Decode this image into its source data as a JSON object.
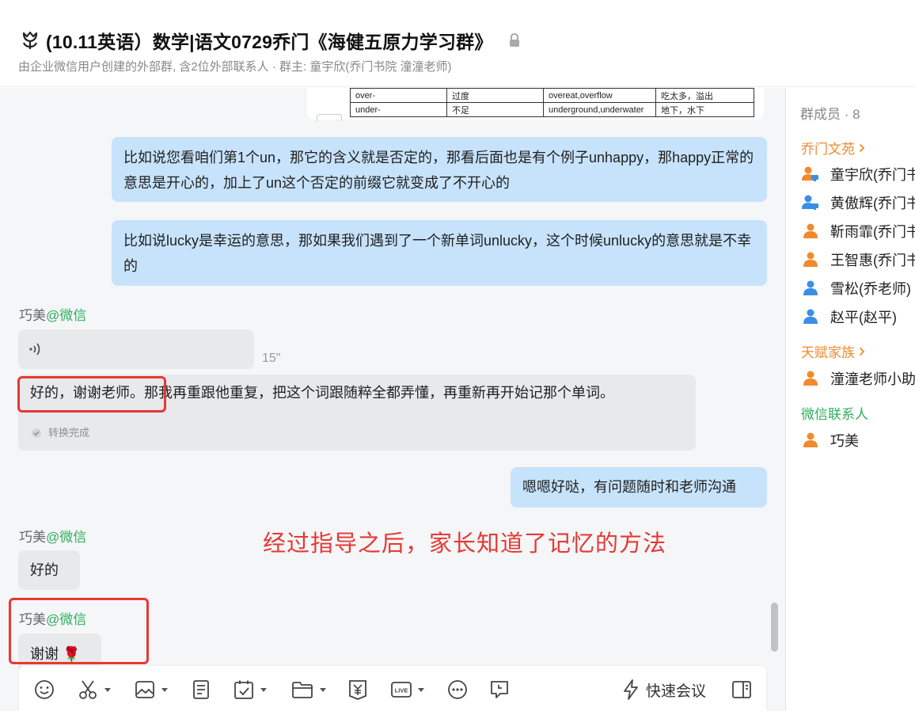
{
  "header": {
    "title": "(10.11英语）数学|语文0729乔门《海健五原力学习群》",
    "subtitle": "由企业微信用户创建的外部群, 含2位外部联系人 · 群主: 童宇欣(乔门书院 潼潼老师)"
  },
  "table_fragment": {
    "rows": [
      [
        "over-",
        "过度",
        "overeat,overflow",
        "吃太多，溢出"
      ],
      [
        "under-",
        "不足",
        "underground,underwater",
        "地下，水下"
      ]
    ]
  },
  "messages": {
    "m1": "比如说您看咱们第1个un，那它的含义就是否定的，那看后面也是有个例子unhappy，那happy正常的意思是开心的，加上了un这个否定的前缀它就变成了不开心的",
    "m2": "比如说lucky是幸运的意思，那如果我们遇到了一个新单词unlucky，这个时候unlucky的意思就是不幸的",
    "voice_duration": "15\"",
    "transcript": "好的，谢谢老师。那我再重跟他重复，把这个词跟随粹全都弄懂，再重新再开始记那个单词。",
    "convert_status": "转换完成",
    "m3": "嗯嗯好哒，有问题随时和老师沟通",
    "m4": "好的",
    "m5": "谢谢 🌹"
  },
  "senders": {
    "name": "巧美",
    "suffix": "@微信"
  },
  "annotation": "经过指导之后，家长知道了记忆的方法",
  "toolbar": {
    "quick_meeting_label": "快速会议",
    "icons": [
      "emoji-icon",
      "scissors-icon",
      "image-icon",
      "document-icon",
      "calendar-check-icon",
      "folder-icon",
      "red-packet-icon",
      "live-icon",
      "more-icon",
      "chat-record-icon",
      "lightning-icon",
      "side-panel-icon"
    ]
  },
  "members_panel": {
    "title": "群成员 · 8",
    "groups": [
      {
        "label": "乔门文苑",
        "members": [
          "童宇欣(乔门书",
          "黄傲辉(乔门书",
          "靳雨霏(乔门书",
          "王智惠(乔门书",
          "雪松(乔老师)",
          "赵平(赵平)"
        ]
      },
      {
        "label": "天赋家族",
        "members": [
          "潼潼老师小助"
        ]
      },
      {
        "label": "微信联系人",
        "members": [
          "巧美"
        ]
      }
    ]
  },
  "colors": {
    "outgoing_bubble": "#c7e3fb",
    "incoming_bubble": "#e8e9eb",
    "wechat_green": "#2fae5e",
    "group_orange": "#f08a2c",
    "annotation_red": "#e53935"
  }
}
